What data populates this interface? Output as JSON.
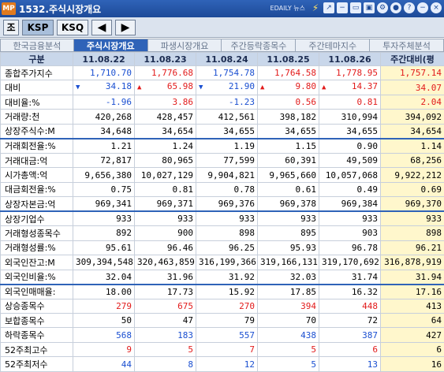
{
  "window": {
    "app_icon": "MP",
    "title": "1532.주식시장개요",
    "brand": "EDAILY 뉴스"
  },
  "toolbar": {
    "b1": "조",
    "b2": "KSP",
    "b3": "KSQ",
    "prev": "◀",
    "next": "▶"
  },
  "tabs": [
    "한국금융분석",
    "주식시장개요",
    "파생시장개요",
    "주간등락종목수",
    "주간테마지수",
    "투자주체분석"
  ],
  "table": {
    "headers": [
      "구분",
      "11.08.22",
      "11.08.23",
      "11.08.24",
      "11.08.25",
      "11.08.26",
      "주간대비(평"
    ],
    "rows": [
      {
        "label": "종합주가지수",
        "cells": [
          "1,710.70",
          "1,776.68",
          "1,754.78",
          "1,764.58",
          "1,778.95",
          "1,757.14"
        ],
        "colors": [
          "down",
          "up",
          "down",
          "up",
          "up",
          "up"
        ]
      },
      {
        "label": "대비",
        "cells": [
          "34.18",
          "65.98",
          "21.90",
          "9.80",
          "14.37",
          "34.07"
        ],
        "colors": [
          "down",
          "up",
          "down",
          "up",
          "up",
          "up"
        ],
        "arrows": [
          "down",
          "up",
          "down",
          "up",
          "up",
          "up"
        ]
      },
      {
        "label": "대비율:%",
        "cells": [
          "-1.96",
          "3.86",
          "-1.23",
          "0.56",
          "0.81",
          "2.04"
        ],
        "colors": [
          "down",
          "up",
          "down",
          "up",
          "up",
          "up"
        ]
      },
      {
        "label": "거래량:천",
        "cells": [
          "420,268",
          "428,457",
          "412,561",
          "398,182",
          "310,994",
          "394,092"
        ]
      },
      {
        "label": "상장주식수:M",
        "cells": [
          "34,648",
          "34,654",
          "34,655",
          "34,655",
          "34,655",
          "34,654"
        ]
      },
      {
        "label": "거래회전율:%",
        "cells": [
          "1.21",
          "1.24",
          "1.19",
          "1.15",
          "0.90",
          "1.14"
        ],
        "sep": true
      },
      {
        "label": "거래대금:억",
        "cells": [
          "72,817",
          "80,965",
          "77,599",
          "60,391",
          "49,509",
          "68,256"
        ]
      },
      {
        "label": "시가총액:억",
        "cells": [
          "9,656,380",
          "10,027,129",
          "9,904,821",
          "9,965,660",
          "10,057,068",
          "9,922,212"
        ]
      },
      {
        "label": "대금회전율:%",
        "cells": [
          "0.75",
          "0.81",
          "0.78",
          "0.61",
          "0.49",
          "0.69"
        ]
      },
      {
        "label": "상장자본금:억",
        "cells": [
          "969,341",
          "969,371",
          "969,376",
          "969,378",
          "969,384",
          "969,370"
        ]
      },
      {
        "label": "상장기업수",
        "cells": [
          "933",
          "933",
          "933",
          "933",
          "933",
          "933"
        ],
        "sep": true
      },
      {
        "label": "거래형성종목수",
        "cells": [
          "892",
          "900",
          "898",
          "895",
          "903",
          "898"
        ]
      },
      {
        "label": "거래형성률:%",
        "cells": [
          "95.61",
          "96.46",
          "96.25",
          "95.93",
          "96.78",
          "96.21"
        ]
      },
      {
        "label": "외국인잔고:M",
        "cells": [
          "309,394,548",
          "320,463,859",
          "316,199,366",
          "319,166,131",
          "319,170,692",
          "316,878,919"
        ]
      },
      {
        "label": "외국인비율:%",
        "cells": [
          "32.04",
          "31.96",
          "31.92",
          "32.03",
          "31.74",
          "31.94"
        ]
      },
      {
        "label": "외국인매매율:",
        "cells": [
          "18.00",
          "17.73",
          "15.92",
          "17.85",
          "16.32",
          "17.16"
        ],
        "sep": true
      },
      {
        "label": "상승종목수",
        "cells": [
          "279",
          "675",
          "270",
          "394",
          "448",
          "413"
        ],
        "colors": [
          "up",
          "up",
          "up",
          "up",
          "up",
          ""
        ]
      },
      {
        "label": "보합종목수",
        "cells": [
          "50",
          "47",
          "79",
          "70",
          "72",
          "64"
        ]
      },
      {
        "label": "하락종목수",
        "cells": [
          "568",
          "183",
          "557",
          "438",
          "387",
          "427"
        ],
        "colors": [
          "down",
          "down",
          "down",
          "down",
          "down",
          ""
        ]
      },
      {
        "label": "52주최고수",
        "cells": [
          "9",
          "5",
          "7",
          "5",
          "6",
          "6"
        ],
        "colors": [
          "up",
          "up",
          "up",
          "up",
          "up",
          ""
        ]
      },
      {
        "label": "52주최저수",
        "cells": [
          "44",
          "8",
          "12",
          "5",
          "13",
          "16"
        ],
        "colors": [
          "down",
          "down",
          "down",
          "down",
          "down",
          ""
        ]
      }
    ]
  },
  "colors": {
    "title_bg": "#1d4a98",
    "active_tab": "#2f63b8",
    "up": "#e21b1b",
    "down": "#1a4fd1",
    "header_bg": "#c9d7ea",
    "last_col_bg": "#fff7cc"
  }
}
